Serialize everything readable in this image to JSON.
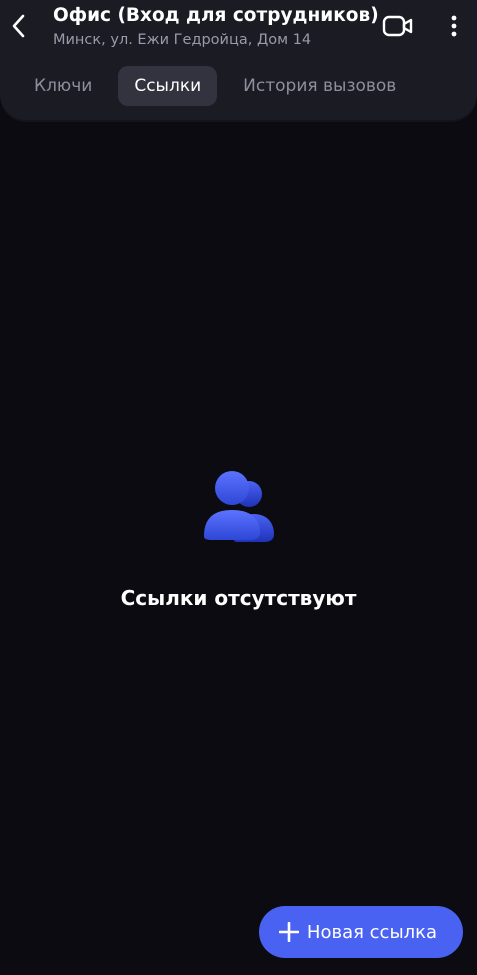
{
  "header": {
    "title": "Офис (Вход для сотрудников)",
    "subtitle": "Минск, ул. Ежи Гедройца, Дом 14",
    "back_icon": "chevron-left-icon",
    "video_icon": "video-camera-icon",
    "more_icon": "more-vertical-icon"
  },
  "tabs": [
    {
      "label": "Ключи",
      "active": false
    },
    {
      "label": "Ссылки",
      "active": true
    },
    {
      "label": "История вызовов",
      "active": false
    }
  ],
  "empty_state": {
    "icon": "users-icon",
    "text": "Ссылки отсутствуют"
  },
  "fab": {
    "icon": "plus-icon",
    "label": "Новая ссылка"
  },
  "colors": {
    "accent": "#4a62f2",
    "background": "#0b0b11",
    "panel": "#1b1b24",
    "active_tab": "#33333f"
  }
}
